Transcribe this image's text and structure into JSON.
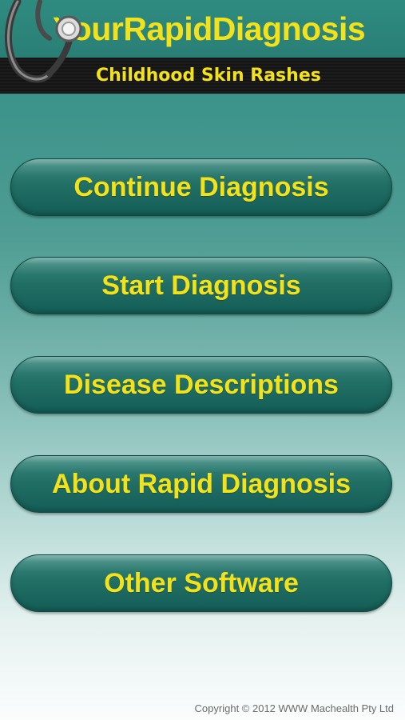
{
  "header": {
    "title": "YourRapidDiagnosis",
    "subtitle": "Childhood Skin Rashes",
    "logo_icon": "stethoscope-icon"
  },
  "menu": {
    "items": [
      {
        "label": "Continue Diagnosis"
      },
      {
        "label": "Start Diagnosis"
      },
      {
        "label": "Disease Descriptions"
      },
      {
        "label": "About Rapid Diagnosis"
      },
      {
        "label": "Other Software"
      }
    ]
  },
  "footer": {
    "copyright": "Copyright © 2012 WWW Machealth Pty Ltd"
  },
  "colors": {
    "accent_text": "#f3e21a",
    "button_base": "#226f66",
    "header_band": "#141414"
  }
}
